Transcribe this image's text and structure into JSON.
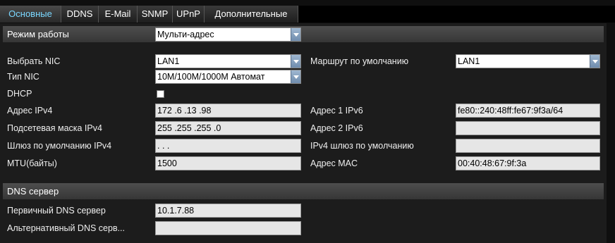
{
  "tabs": [
    {
      "label": "Основные"
    },
    {
      "label": "DDNS"
    },
    {
      "label": "E-Mail"
    },
    {
      "label": "SNMP"
    },
    {
      "label": "UPnP"
    },
    {
      "label": "Дополнительные"
    }
  ],
  "work_mode": {
    "label": "Режим работы",
    "value": "Мульти-адрес"
  },
  "nic": {
    "select_label": "Выбрать NIC",
    "select_value": "LAN1",
    "type_label": "Тип NIC",
    "type_value": "10M/100M/1000M Автомат",
    "dhcp_label": "DHCP"
  },
  "ipv4": {
    "address_label": "Адрес IPv4",
    "address_value": "172 .6    .13   .98",
    "mask_label": "Подсетевая маска IPv4",
    "mask_value": "255 .255 .255 .0",
    "gateway_label": "Шлюз по умолчанию IPv4",
    "gateway_value": "    .     .     .",
    "mtu_label": "MTU(байты)",
    "mtu_value": "1500"
  },
  "right": {
    "route_label": "Маршрут по умолчанию",
    "route_value": "LAN1",
    "ipv6_1_label": "Адрес 1 IPv6",
    "ipv6_1_value": "fe80::240:48ff:fe67:9f3a/64",
    "ipv6_2_label": "Адрес 2 IPv6",
    "ipv6_2_value": "",
    "ipv4_gw_label": "IPv4 шлюз по умолчанию",
    "ipv4_gw_value": "",
    "mac_label": "Адрес MAC",
    "mac_value": "00:40:48:67:9f:3a"
  },
  "dns": {
    "section_title": "DNS сервер",
    "primary_label": "Первичный DNS сервер",
    "primary_value": "10.1.7.88",
    "alt_label": "Альтернативный DNS серв...",
    "alt_value": ""
  }
}
